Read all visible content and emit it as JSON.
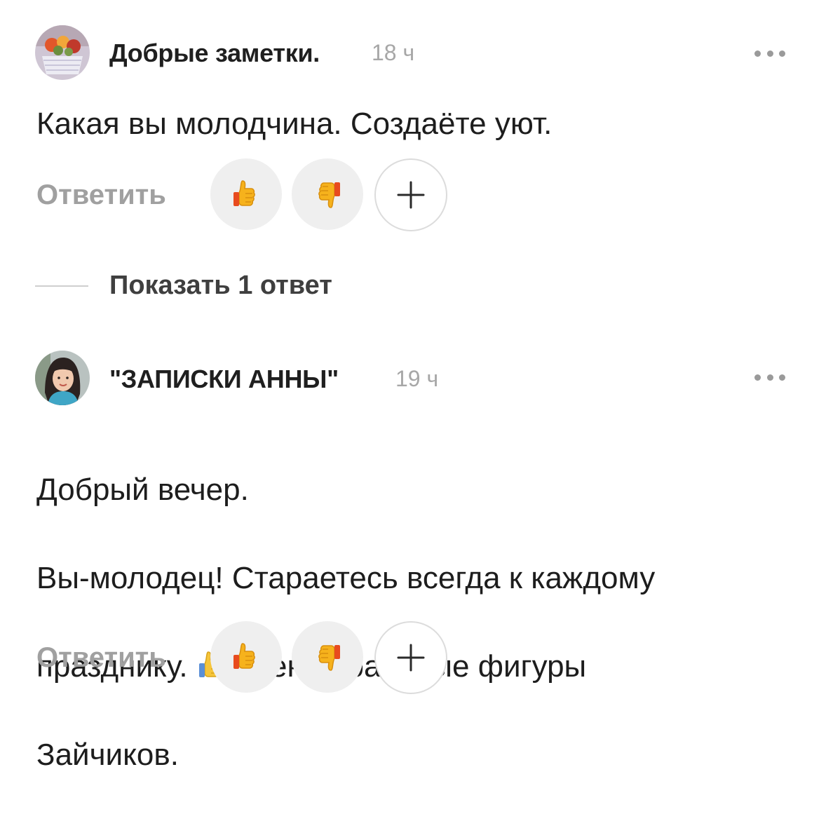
{
  "comments": [
    {
      "author": "Добрые заметки.",
      "time": "18 ч",
      "text": "Какая вы молодчина. Создаёте уют.",
      "reply_label": "Ответить",
      "avatar_icon": "avatar-flower-basket",
      "like_icon": "thumbs-up-icon",
      "dislike_icon": "thumbs-down-icon",
      "add_icon": "plus-icon",
      "more_icon": "ellipsis-icon"
    },
    {
      "author": "\"ЗАПИСКИ АННЫ\"",
      "time": "19 ч",
      "text_line1": "Добрый вечер.",
      "text_line2": "Вы-молодец! Стараетесь всегда к каждому",
      "text_line3_before": "празднику.",
      "text_line3_after": "Очень Красивые фигуры",
      "text_line4": "Зайчиков.",
      "reply_label": "Ответить",
      "avatar_icon": "avatar-woman-photo",
      "like_icon": "thumbs-up-icon",
      "dislike_icon": "thumbs-down-icon",
      "add_icon": "plus-icon",
      "more_icon": "ellipsis-icon"
    }
  ],
  "show_replies_label": "Показать 1 ответ",
  "colors": {
    "author": "#1f1f1f",
    "time": "#a7a7a7",
    "reply": "#a0a0a0",
    "button_bg": "#efefef",
    "thumb": "#f6b21c",
    "thumb_cuff": "#e84b1e"
  }
}
